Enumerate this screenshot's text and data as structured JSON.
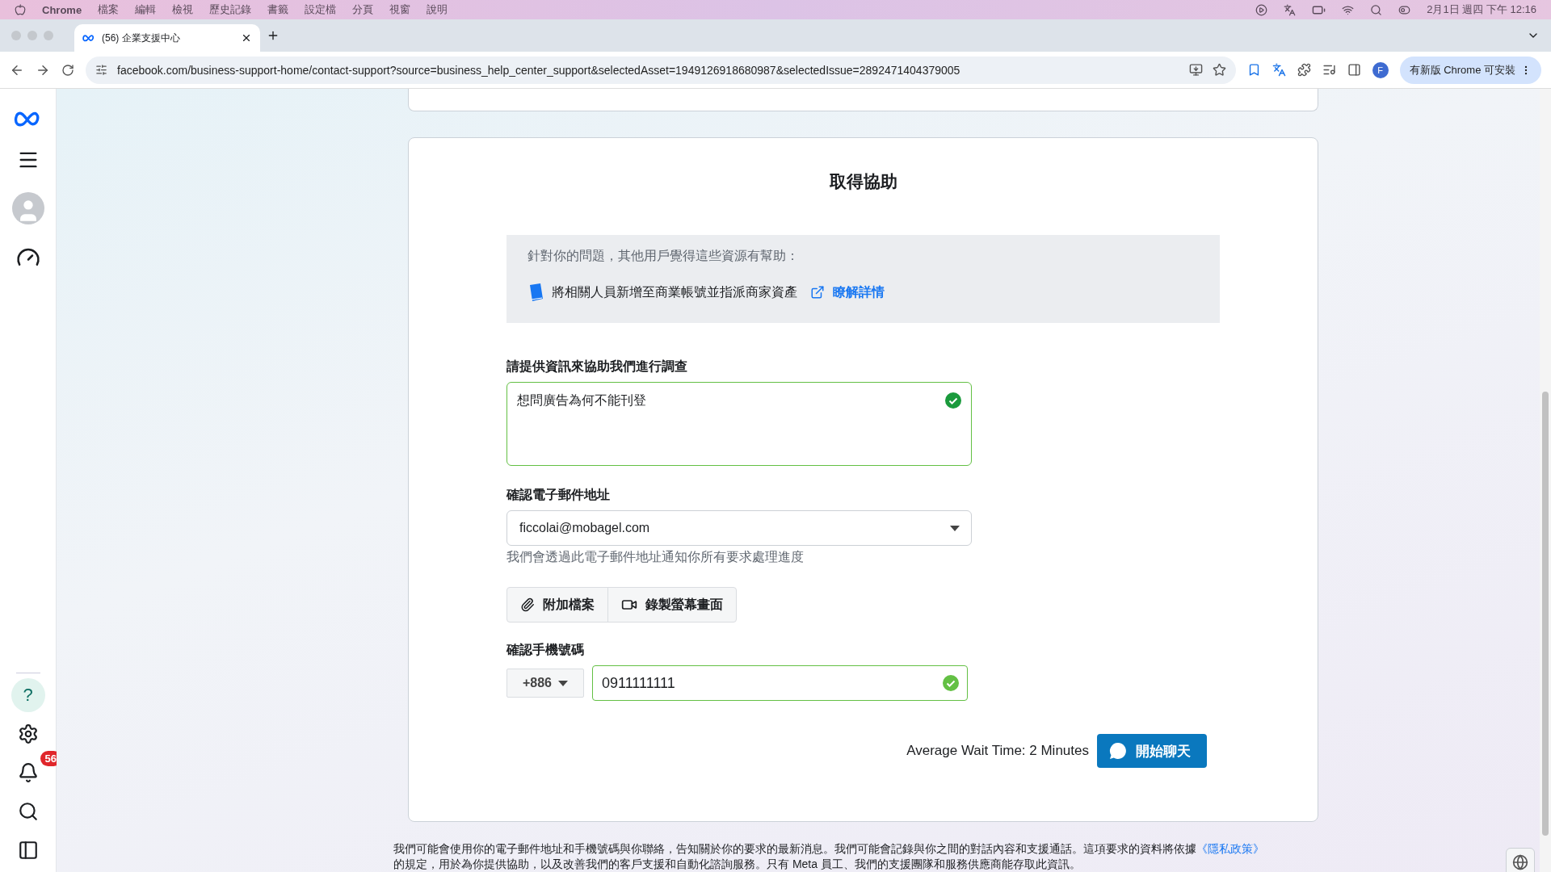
{
  "menu_bar": {
    "app": "Chrome",
    "items": [
      "檔案",
      "編輯",
      "檢視",
      "歷史記錄",
      "書籤",
      "設定檔",
      "分頁",
      "視窗",
      "說明"
    ],
    "clock": "2月1日 週四 下午 12:16"
  },
  "browser": {
    "tabs": [
      {
        "title": "(56) 企業支援中心",
        "selected": true
      }
    ],
    "url": "facebook.com/business-support-home/contact-support?source=business_help_center_support&selectedAsset=1949126918680987&selectedIssue=2892471404379005",
    "profile": "F",
    "update_button": "有新版 Chrome 可安裝"
  },
  "sidebar": {
    "items": [
      {
        "kind": "help",
        "icon": "?",
        "selected": true
      },
      {
        "kind": "settings",
        "selected": false
      },
      {
        "kind": "notifications",
        "selected": false,
        "badge": "56"
      },
      {
        "kind": "search",
        "selected": false
      },
      {
        "kind": "panel",
        "selected": false
      }
    ]
  },
  "card": {
    "title": "取得協助",
    "resources": {
      "intro": "針對你的問題，其他用戶覺得這些資源有幫助：",
      "items": [
        {
          "text": "將相關人員新增至商業帳號並指派商家資產",
          "link": "瞭解詳情"
        }
      ]
    },
    "description": {
      "label": "請提供資訊來協助我們進行調查",
      "value": "想問廣告為何不能刊登",
      "valid": true
    },
    "email": {
      "label": "確認電子郵件地址",
      "value": "ficcolai@mobagel.com",
      "help": "我們會透過此電子郵件地址通知你所有要求處理進度"
    },
    "attachments": [
      {
        "kind": "file",
        "label": "附加檔案"
      },
      {
        "kind": "record",
        "label": "錄製螢幕畫面"
      }
    ],
    "phone": {
      "label": "確認手機號碼",
      "country_code": "+886",
      "value": "0911111111",
      "valid": true
    },
    "wait_time": "Average Wait Time: 2 Minutes",
    "chat_button": "開始聊天"
  },
  "footer": {
    "text": "我們可能會使用你的電子郵件地址和手機號碼與你聯絡，告知關於你的要求的最新消息。我們可能會記錄與你之間的對話內容和支援通話。這項要求的資料將依據",
    "link": "《隱私政策》",
    "text_2": "的規定，用於為你提供協助，以及改善我們的客戶支援和自動化諮詢服務。只有 Meta 員工、我們的支援團隊和服務供應商能存取此資訊。"
  }
}
